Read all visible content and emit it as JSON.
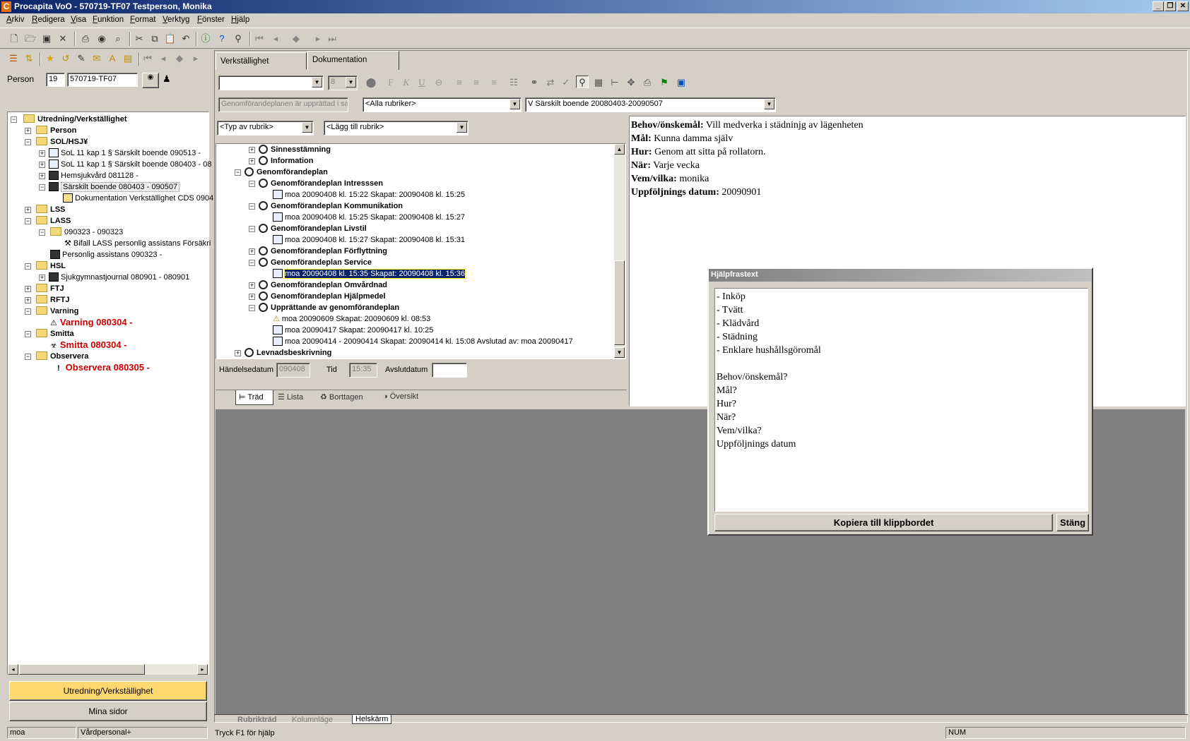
{
  "window": {
    "title": "Procapita VoO - 570719-TF07 Testperson, Monika",
    "icon": "C"
  },
  "menu": [
    "Arkiv",
    "Redigera",
    "Visa",
    "Funktion",
    "Format",
    "Verktyg",
    "Fönster",
    "Hjälp"
  ],
  "person": {
    "label": "Person",
    "num": "19",
    "id": "570719-TF07"
  },
  "left_tree": {
    "root": "Utredning/Verkställighet",
    "person": "Person",
    "sol": "SOL/HSJ¥",
    "sol_items": [
      "SoL 11 kap 1 § Särskilt boende 090513 -",
      "SoL 11 kap 1 § Särskilt boende 080403 - 08",
      "Hemsjukvård 081128 -",
      "Särskilt boende 080403 - 090507"
    ],
    "doc_item": "Dokumentation Verkställighet CDS 0904",
    "lss": "LSS",
    "lass": "LASS",
    "lass_sub": "090323 - 090323",
    "lass_bifall": "Bifall LASS personlig assistans Försäkri",
    "lass_pa": "Personlig assistans 090323 -",
    "hsl": "HSL",
    "hsl_item": "Sjukgymnastjournal 080901 - 080901",
    "ftj": "FTJ",
    "rftj": "RFTJ",
    "varning": "Varning",
    "varning_item": "Varning 080304 -",
    "smitta": "Smitta",
    "smitta_item": "Smitta 080304 -",
    "observera": "Observera",
    "observera_item": "Observera 080305 -"
  },
  "left_buttons": {
    "active": "Utredning/Verkställighet",
    "other": "Mina sidor"
  },
  "status": {
    "user": "moa",
    "role": "Vårdpersonal+",
    "hint": "Tryck F1 för hjälp",
    "num": "NUM"
  },
  "tabs": {
    "verk": "Verkställighet",
    "dok": "Dokumentation"
  },
  "fmt": {
    "size": "8"
  },
  "filters": {
    "plan": "Genomförandeplanen är upprättad i sa",
    "rubriker": "<Alla rubriker>",
    "insats": "V Särskilt boende 20080403-20090507",
    "typ": "<Typ av rubrik>",
    "lagg": "<Lägg till rubrik>"
  },
  "doc_tree": [
    {
      "t": "Sinnesstämning",
      "b": true
    },
    {
      "t": "Information",
      "b": true
    },
    {
      "t": "Genomförandeplan",
      "b": true
    },
    {
      "t": "Genomförandeplan Intresssen",
      "b": true
    },
    {
      "t": "moa 20090408  kl. 15:22  Skapat: 20090408 kl. 15:25",
      "b": false
    },
    {
      "t": "Genomförandeplan Kommunikation",
      "b": true
    },
    {
      "t": "moa 20090408  kl. 15:25  Skapat: 20090408 kl. 15:27",
      "b": false
    },
    {
      "t": "Genomförandeplan Livstil",
      "b": true
    },
    {
      "t": "moa 20090408  kl. 15:27  Skapat: 20090408 kl. 15:31",
      "b": false
    },
    {
      "t": "Genomförandeplan Förflyttning",
      "b": true
    },
    {
      "t": "Genomförandeplan Service",
      "b": true
    },
    {
      "t": "moa 20090408  kl. 15:35  Skapat: 20090408 kl. 15:36",
      "b": false
    },
    {
      "t": "Genomförandeplan Omvårdnad",
      "b": true
    },
    {
      "t": "Genomförandeplan Hjälpmedel",
      "b": true
    },
    {
      "t": "Upprättande av genomförandeplan",
      "b": true
    },
    {
      "t": "moa 20090609 Skapat: 20090609 kl. 08:53",
      "b": false
    },
    {
      "t": "moa 20090417 Skapat: 20090417 kl. 10:25",
      "b": false
    },
    {
      "t": "moa 20090414 - 20090414 Skapat: 20090414 kl. 15:08  Avslutad av: moa 20090417",
      "b": false
    },
    {
      "t": "Levnadsbeskrivning",
      "b": true
    }
  ],
  "date_fields": {
    "handelse_label": "Händelsedatum",
    "handelse": "090408",
    "tid_label": "Tid",
    "tid": "15:35",
    "avslut_label": "Avslutdatum",
    "avslut": ""
  },
  "view_tabs": [
    "Träd",
    "Lista",
    "Borttagen",
    "Översikt"
  ],
  "doc_text": [
    {
      "k": "Behov/önskemål:",
      "v": "  Vill medverka i städninjg av lägenheten"
    },
    {
      "k": "Mål:",
      "v": " Kunna damma själv"
    },
    {
      "k": "Hur:",
      "v": "  Genom att sitta på rollatorn."
    },
    {
      "k": "När:",
      "v": "  Varje vecka"
    },
    {
      "k": "Vem/vilka:",
      "v": " monika"
    },
    {
      "k": "Uppföljnings datum:",
      "v": " 20090901"
    }
  ],
  "dialog": {
    "title": "Hjälpfrastext",
    "lines": [
      "- Inköp",
      "- Tvätt",
      "- Klädvård",
      "- Städning",
      "- Enklare hushållsgöromål",
      "",
      "Behov/önskemål?",
      "Mål?",
      "Hur?",
      "När?",
      "Vem/vilka?",
      "Uppföljnings datum"
    ],
    "copy": "Kopiera till klippbordet",
    "close": "Stäng"
  },
  "bottom_tabs": [
    "Rubrikträd",
    "Kolumnläge",
    "Helskärm"
  ]
}
